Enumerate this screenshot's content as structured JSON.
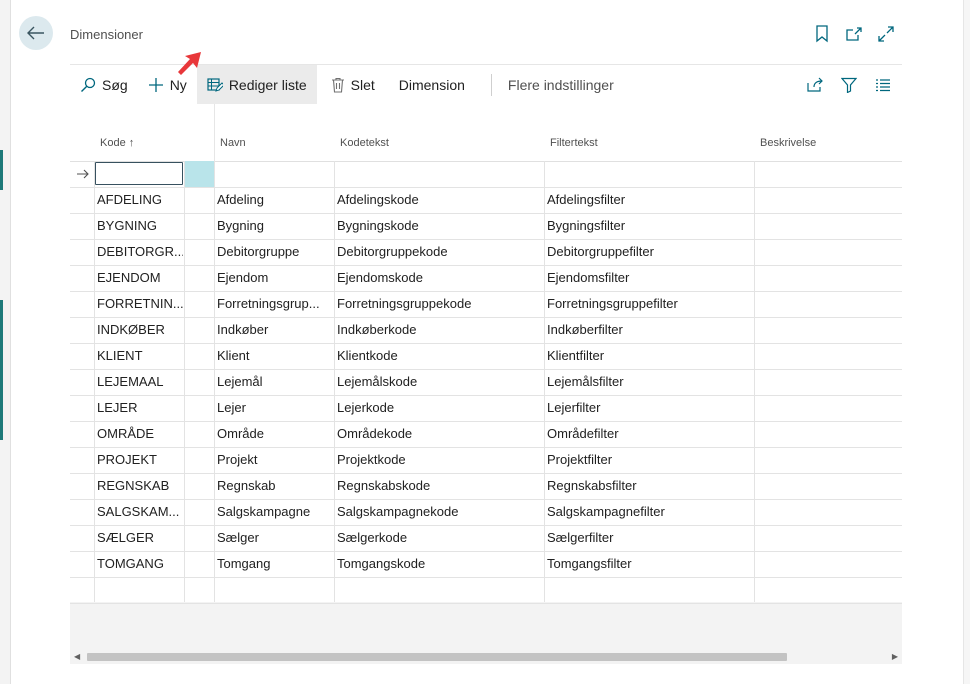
{
  "page": {
    "title": "Dimensioner"
  },
  "actions": {
    "search": "Søg",
    "new": "Ny",
    "edit_list": "Rediger liste",
    "delete": "Slet",
    "dimension": "Dimension",
    "more": "Flere indstillinger"
  },
  "grid": {
    "columns": {
      "kode": "Kode",
      "sort_indicator": "↑",
      "navn": "Navn",
      "kodetekst": "Kodetekst",
      "filtertekst": "Filtertekst",
      "beskrivelse": "Beskrivelse"
    },
    "rows": [
      {
        "kode": "AFDELING",
        "navn": "Afdeling",
        "kodetekst": "Afdelingskode",
        "filtertekst": "Afdelingsfilter"
      },
      {
        "kode": "BYGNING",
        "navn": "Bygning",
        "kodetekst": "Bygningskode",
        "filtertekst": "Bygningsfilter"
      },
      {
        "kode": "DEBITORGR...",
        "navn": "Debitorgruppe",
        "kodetekst": "Debitorgruppekode",
        "filtertekst": "Debitorgruppefilter"
      },
      {
        "kode": "EJENDOM",
        "navn": "Ejendom",
        "kodetekst": "Ejendomskode",
        "filtertekst": "Ejendomsfilter"
      },
      {
        "kode": "FORRETNIN...",
        "navn": "Forretningsgrup...",
        "kodetekst": "Forretningsgruppekode",
        "filtertekst": "Forretningsgruppefilter"
      },
      {
        "kode": "INDKØBER",
        "navn": "Indkøber",
        "kodetekst": "Indkøberkode",
        "filtertekst": "Indkøberfilter"
      },
      {
        "kode": "KLIENT",
        "navn": "Klient",
        "kodetekst": "Klientkode",
        "filtertekst": "Klientfilter"
      },
      {
        "kode": "LEJEMAAL",
        "navn": "Lejemål",
        "kodetekst": "Lejemålskode",
        "filtertekst": "Lejemålsfilter"
      },
      {
        "kode": "LEJER",
        "navn": "Lejer",
        "kodetekst": "Lejerkode",
        "filtertekst": "Lejerfilter"
      },
      {
        "kode": "OMRÅDE",
        "navn": "Område",
        "kodetekst": "Områdekode",
        "filtertekst": "Områdefilter"
      },
      {
        "kode": "PROJEKT",
        "navn": "Projekt",
        "kodetekst": "Projektkode",
        "filtertekst": "Projektfilter"
      },
      {
        "kode": "REGNSKAB",
        "navn": "Regnskab",
        "kodetekst": "Regnskabskode",
        "filtertekst": "Regnskabsfilter"
      },
      {
        "kode": "SALGSKAM...",
        "navn": "Salgskampagne",
        "kodetekst": "Salgskampagnekode",
        "filtertekst": "Salgskampagnefilter"
      },
      {
        "kode": "SÆLGER",
        "navn": "Sælger",
        "kodetekst": "Sælgerkode",
        "filtertekst": "Sælgerfilter"
      },
      {
        "kode": "TOMGANG",
        "navn": "Tomgang",
        "kodetekst": "Tomgangskode",
        "filtertekst": "Tomgangsfilter"
      }
    ]
  },
  "colors": {
    "accent": "#00677e",
    "selection": "#b9e4ea",
    "active_action": "#ebebeb",
    "annotation_arrow": "#e8373a"
  }
}
